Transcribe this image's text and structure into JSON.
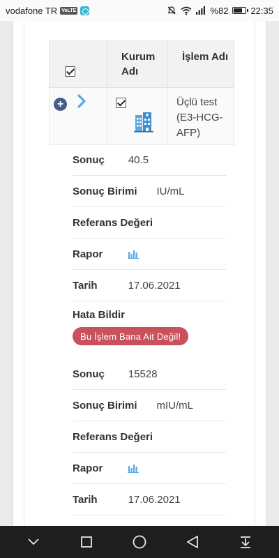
{
  "status_bar": {
    "carrier": "vodafone TR",
    "volte": "VoLTE",
    "battery_text": "%82",
    "battery_level": 0.82,
    "time": "22:35"
  },
  "table": {
    "headers": {
      "kurum": "Kurum Adı",
      "islem": "İşlem Adı"
    },
    "row": {
      "islem_name": "Üçlü test (E3-HCG-AFP)"
    }
  },
  "results": [
    {
      "sonuc_label": "Sonuç",
      "sonuc_value": "40.5",
      "birim_label": "Sonuç Birimi",
      "birim_value": "IU/mL",
      "referans_label": "Referans Değeri",
      "rapor_label": "Rapor",
      "tarih_label": "Tarih",
      "tarih_value": "17.06.2021"
    },
    {
      "sonuc_label": "Sonuç",
      "sonuc_value": "15528",
      "birim_label": "Sonuç Birimi",
      "birim_value": "mIU/mL",
      "referans_label": "Referans Değeri",
      "rapor_label": "Rapor",
      "tarih_label": "Tarih",
      "tarih_value": "17.06.2021"
    }
  ],
  "hata": {
    "label": "Hata Bildir",
    "button": "Bu İşlem Bana Ait Değil!"
  },
  "colors": {
    "accent_blue": "#5aa7e0",
    "error_button": "#c9515c",
    "plus_button": "#425c8d"
  },
  "icons": [
    "plus-circle-icon",
    "chevron-right-icon",
    "hospital-building-icon",
    "bar-chart-icon"
  ]
}
